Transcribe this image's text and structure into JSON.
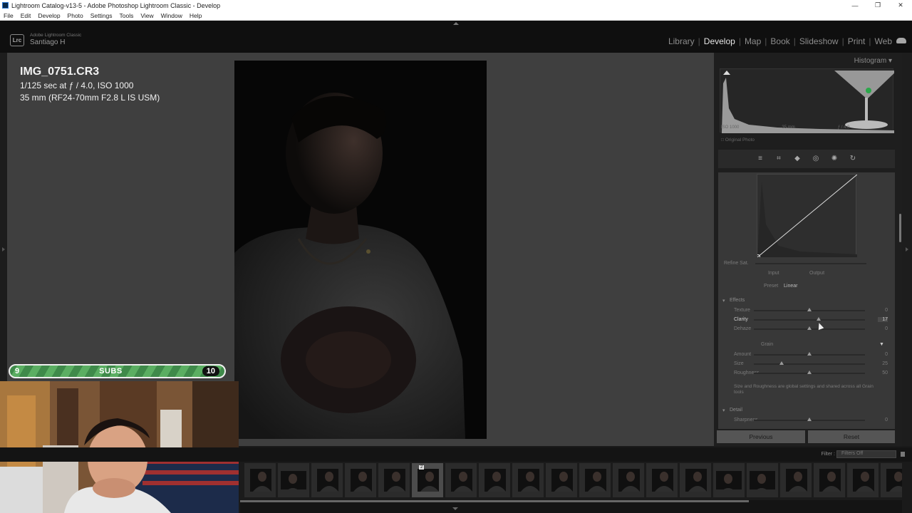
{
  "window": {
    "title": "Lightroom Catalog-v13-5 - Adobe Photoshop Lightroom Classic - Develop",
    "controls": [
      "—",
      "❐",
      "✕"
    ]
  },
  "menu": [
    "File",
    "Edit",
    "Develop",
    "Photo",
    "Settings",
    "Tools",
    "View",
    "Window",
    "Help"
  ],
  "header": {
    "logo": "Lrc",
    "brand": "Adobe Lightroom Classic",
    "user": "Santiago H",
    "modules": [
      "Library",
      "Develop",
      "Map",
      "Book",
      "Slideshow",
      "Print",
      "Web"
    ],
    "active_module": "Develop",
    "cloud_icon": "cloud-icon"
  },
  "info": {
    "filename": "IMG_0751.CR3",
    "exposure": "1/125 sec at ƒ / 4.0, ISO 1000",
    "lens": "35 mm (RF24-70mm F2.8 L IS USM)"
  },
  "subs": {
    "current": "9",
    "label": "SUBS",
    "goal": "10",
    "progress": 0.9,
    "color": "#4fa158"
  },
  "histogram": {
    "title": "Histogram",
    "info": [
      "ISO 1000",
      "35 mm",
      "ƒ / 4.0"
    ],
    "original_photo": "Original Photo"
  },
  "tools": [
    "sliders-icon",
    "crop-icon",
    "eraser-icon",
    "redeye-icon",
    "masking-icon",
    "reset-icon"
  ],
  "tone_curve": {
    "refine_label": "Refine Sat.",
    "input_label": "Input",
    "output_label": "Output",
    "preset_label": "Preset",
    "preset_value": "Linear"
  },
  "effects": {
    "title": "Effects",
    "sliders": [
      {
        "label": "Texture",
        "value": "0",
        "level": 0.5
      },
      {
        "label": "Clarity",
        "value": "17",
        "level": 0.585
      },
      {
        "label": "Dehaze",
        "value": "0",
        "level": 0.5
      }
    ]
  },
  "grain": {
    "title": "Grain",
    "sliders": [
      {
        "label": "Amount",
        "value": "0",
        "level": 0.5
      },
      {
        "label": "Size",
        "value": "25",
        "level": 0.25
      },
      {
        "label": "Roughness",
        "value": "50",
        "level": 0.5
      }
    ],
    "note": "Size and Roughness are global settings and shared across all Grain tools"
  },
  "detail": {
    "title": "Detail",
    "sliders": [
      {
        "label": "Sharpness",
        "value": "0",
        "level": 0.5
      }
    ]
  },
  "buttons": {
    "previous": "Previous",
    "reset": "Reset"
  },
  "filmstrip": {
    "filter_label": "Filter :",
    "filter_value": "Filters Off",
    "selected_index": 5,
    "badge": "2"
  }
}
